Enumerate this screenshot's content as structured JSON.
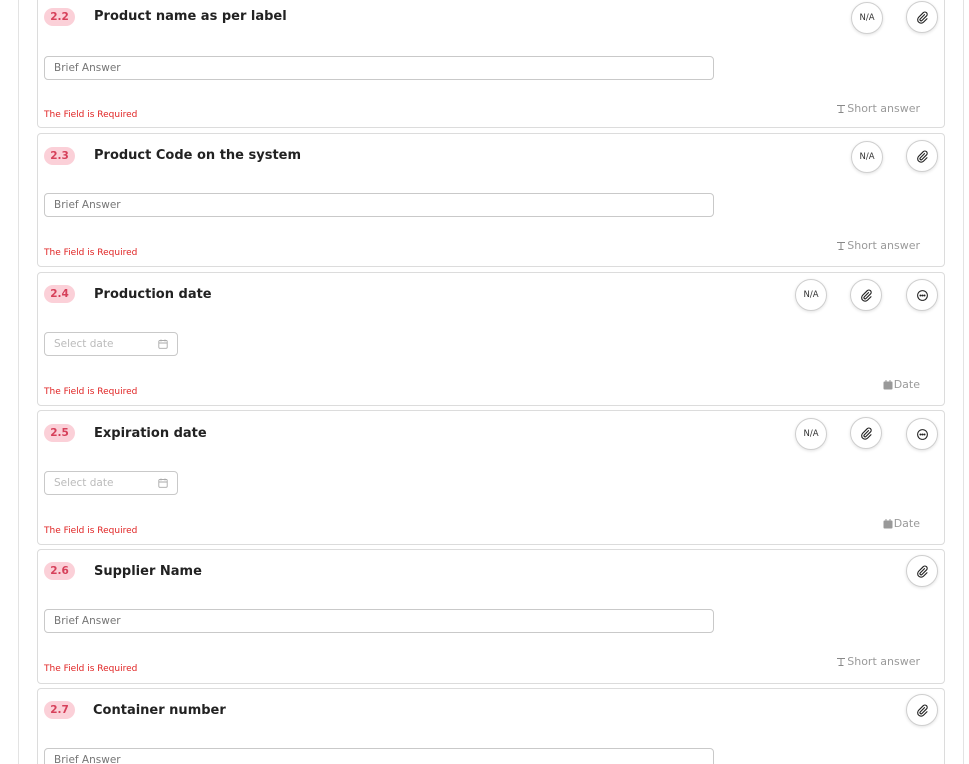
{
  "questions": [
    {
      "number": "2.2",
      "title": "Product name as per label",
      "placeholder": "Brief Answer",
      "required_msg": "The Field is Required",
      "type_label": "Short answer"
    },
    {
      "number": "2.3",
      "title": "Product Code on the system",
      "placeholder": "Brief Answer",
      "required_msg": "The Field is Required",
      "type_label": "Short answer"
    },
    {
      "number": "2.4",
      "title": "Production date",
      "placeholder": "Select date",
      "required_msg": "The Field is Required",
      "type_label": "Date"
    },
    {
      "number": "2.5",
      "title": "Expiration date",
      "placeholder": "Select date",
      "required_msg": "The Field is Required",
      "type_label": "Date"
    },
    {
      "number": "2.6",
      "title": "Supplier Name",
      "placeholder": "Brief Answer",
      "required_msg": "The Field is Required",
      "type_label": "Short answer"
    },
    {
      "number": "2.7",
      "title": "Container number",
      "placeholder": "Brief Answer"
    }
  ],
  "na_label": "N/A",
  "icons": {
    "attach": "paperclip-icon",
    "comment": "comment-icon",
    "calendar": "calendar-icon",
    "short_answer": "text-type-icon"
  },
  "colors": {
    "badge_bg": "#fbd0d8",
    "badge_text": "#d6405a",
    "required": "#e02424",
    "muted": "#9a9a9a"
  }
}
